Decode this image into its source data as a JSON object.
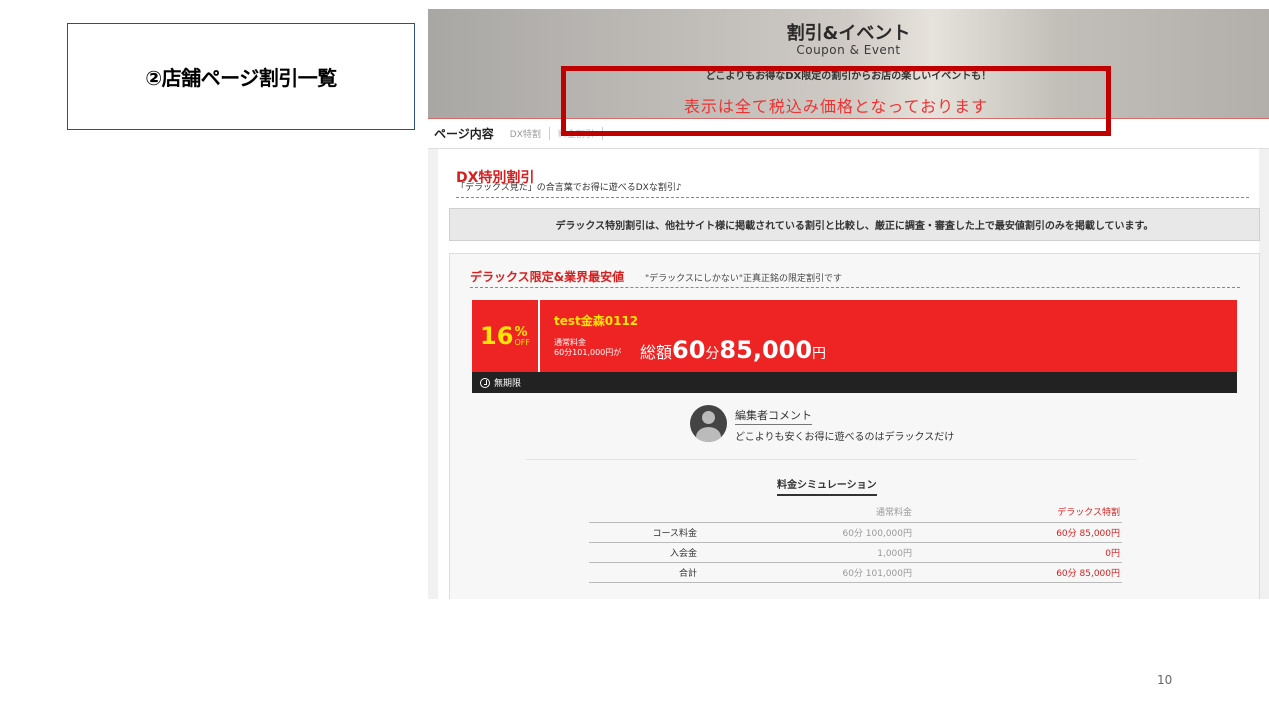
{
  "slide": {
    "label": "②店舗ページ割引一覧",
    "page_number": "10"
  },
  "hero": {
    "title": "割引&イベント",
    "subtitle": "Coupon & Event",
    "tagline": "どこよりもお得なDX限定の割引からお店の楽しいイベントも！",
    "tax_note": "表示は全て税込み価格となっております"
  },
  "tabs": {
    "main": "ページ内容",
    "items": [
      "DX特割",
      "料金割引"
    ]
  },
  "section": {
    "title": "DX特別割引",
    "description": "「デラックス見た」の合言葉でお得に遊べるDXな割引♪",
    "notice": "デラックス特別割引は、他社サイト様に掲載されている割引と比較し、厳正に調査・審査した上で最安値割引のみを掲載しています。"
  },
  "limited": {
    "title": "デラックス限定&業界最安値",
    "description": "\"デラックスにしかない\"正真正銘の限定割引です"
  },
  "coupon": {
    "percent": "16",
    "percent_sign": "%",
    "off": "OFF",
    "name": "test金森0112",
    "regular_label": "通常料金",
    "regular_price": "60分101,000円が",
    "total_word": "総額",
    "total_minutes": "60",
    "total_minutes_unit": "分",
    "total_price": "85,000",
    "total_yen": "円",
    "expiry": "無期限"
  },
  "editor": {
    "label": "編集者コメント",
    "comment": "どこよりも安くお得に遊べるのはデラックスだけ"
  },
  "simulation": {
    "title": "料金シミュレーション",
    "headers": [
      "",
      "通常料金",
      "デラックス特割"
    ],
    "rows": [
      [
        "コース料金",
        "60分 100,000円",
        "60分 85,000円"
      ],
      [
        "入会金",
        "1,000円",
        "0円"
      ],
      [
        "合計",
        "60分 101,000円",
        "60分 85,000円"
      ]
    ]
  },
  "colors": {
    "accent_red": "#ee2424",
    "highlight_yellow": "#ffe600",
    "frame_red": "#c00000"
  }
}
